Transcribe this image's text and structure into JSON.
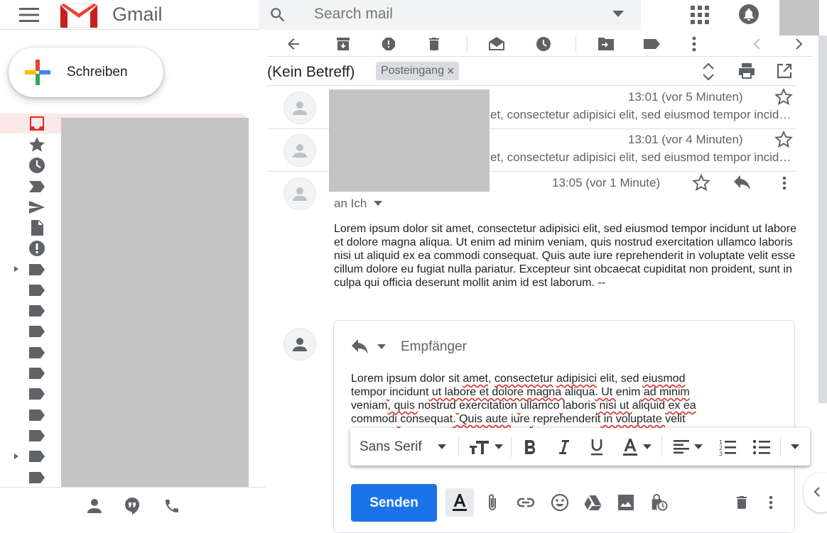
{
  "app": {
    "logo_text": "Gmail"
  },
  "search": {
    "placeholder": "Search mail"
  },
  "compose": {
    "label": "Schreiben"
  },
  "thread": {
    "subject": "(Kein Betreff)",
    "label_chip": "Posteingang",
    "label_chip_close": "×"
  },
  "messages": [
    {
      "time": "13:01 (vor 5 Minuten)",
      "snippet": "et, consectetur adipisici elit, sed eiusmod tempor incidunt ut labore"
    },
    {
      "time": "13:01 (vor 4 Minuten)",
      "snippet": "et, consectetur adipisici elit, sed eiusmod tempor incidunt ut labore"
    },
    {
      "time": "13:05 (vor 1 Minute)",
      "recipient": "an Ich",
      "body": "Lorem ipsum dolor sit amet, consectetur adipisici elit, sed eiusmod tempor incidunt ut labore et dolore magna aliqua. Ut enim ad minim veniam, quis nostrud exercitation ullamco laboris nisi ut aliquid ex ea commodi consequat. Quis aute iure reprehenderit in voluptate velit esse cillum dolore eu fugiat nulla pariatur. Excepteur sint obcaecat cupiditat non proident, sunt in culpa qui officia deserunt mollit anim id est laborum. --"
    }
  ],
  "reply": {
    "recipients_placeholder": "Empfänger",
    "lines": [
      [
        "Lorem ipsum dolor sit ",
        "amet",
        ", ",
        "consectetur",
        " ",
        "adipisici",
        " elit, sed ",
        "eiusmod"
      ],
      [
        "tempor",
        " ",
        "incidunt",
        " ut labore et dolore magna ",
        "aliqua",
        ". Ut ",
        "enim",
        " ad minim"
      ],
      [
        "veniam",
        ", quis ",
        "nostrud",
        " ",
        "exercitation",
        " ",
        "ullamco",
        " ",
        "laboris",
        " nisi ut ",
        "aliquid",
        " ex ea"
      ],
      [
        "commodi",
        " ",
        "consequat",
        ". Quis aute ",
        "iure",
        " ",
        "reprehenderit",
        " in voluptate ",
        "velit"
      ]
    ],
    "font_select": "Sans Serif",
    "send_label": "Senden"
  },
  "colors": {
    "accent": "#1a73e8",
    "selected_bg": "#fce8e6",
    "selected_icon": "#d93025",
    "redacted": "#c4c4c4"
  }
}
